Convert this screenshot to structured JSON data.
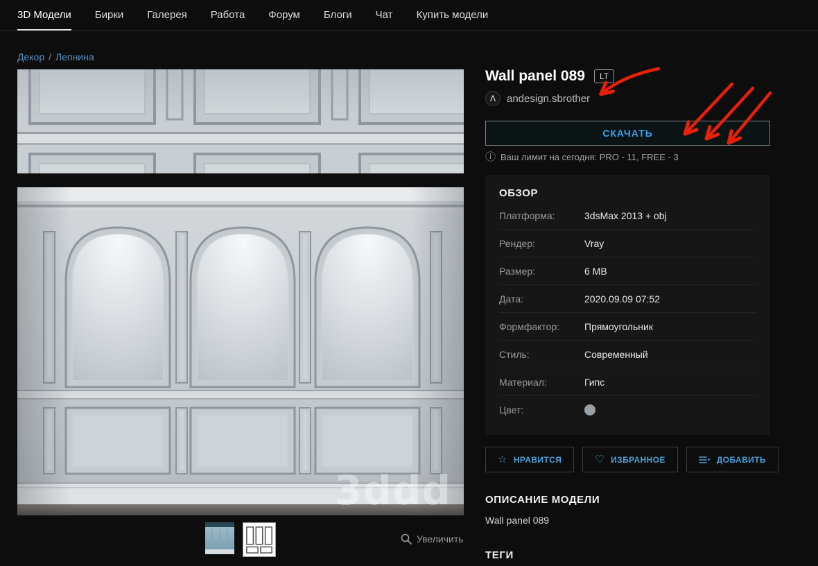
{
  "nav": {
    "items": [
      {
        "label": "3D Модели",
        "active": true
      },
      {
        "label": "Бирки"
      },
      {
        "label": "Галерея"
      },
      {
        "label": "Работа"
      },
      {
        "label": "Форум"
      },
      {
        "label": "Блоги"
      },
      {
        "label": "Чат"
      },
      {
        "label": "Купить модели"
      }
    ]
  },
  "breadcrumb": {
    "items": [
      "Декор",
      "Лепнина"
    ],
    "separator": "/"
  },
  "product": {
    "title": "Wall panel 089",
    "badge": "LT",
    "author": "andesign.sbrother",
    "download_label": "СКАЧАТЬ",
    "limit_text": "Ваш лимит на сегодня: PRO - 11, FREE - 3"
  },
  "overview": {
    "title": "ОБЗОР",
    "color_swatch": "#9aa0a3",
    "rows": [
      {
        "label": "Платформа:",
        "value": "3dsMax 2013 + obj"
      },
      {
        "label": "Рендер:",
        "value": "Vray"
      },
      {
        "label": "Размер:",
        "value": "6 MB"
      },
      {
        "label": "Дата:",
        "value": "2020.09.09 07:52"
      },
      {
        "label": "Формфактор:",
        "value": "Прямоугольник"
      },
      {
        "label": "Стиль:",
        "value": "Современный"
      },
      {
        "label": "Материал:",
        "value": "Гипс"
      },
      {
        "label": "Цвет:",
        "value": ""
      }
    ]
  },
  "actions": {
    "like": "НРАВИТСЯ",
    "favorite": "ИЗБРАННОЕ",
    "add": "ДОБАВИТЬ"
  },
  "description": {
    "title": "ОПИСАНИЕ МОДЕЛИ",
    "text": "Wall panel 089"
  },
  "tags": {
    "title": "ТЕГИ"
  },
  "viewer": {
    "zoom_label": "Увеличить",
    "watermark": "3ddd"
  },
  "icons": {
    "info": "ⓘ",
    "star": "☆",
    "heart": "♡",
    "avatar": "Λ"
  },
  "colors": {
    "accent_blue": "#4d9fd6",
    "link_blue": "#5e8fc2",
    "annotation_red": "#e8200a",
    "download_blue": "#38a3f1"
  }
}
